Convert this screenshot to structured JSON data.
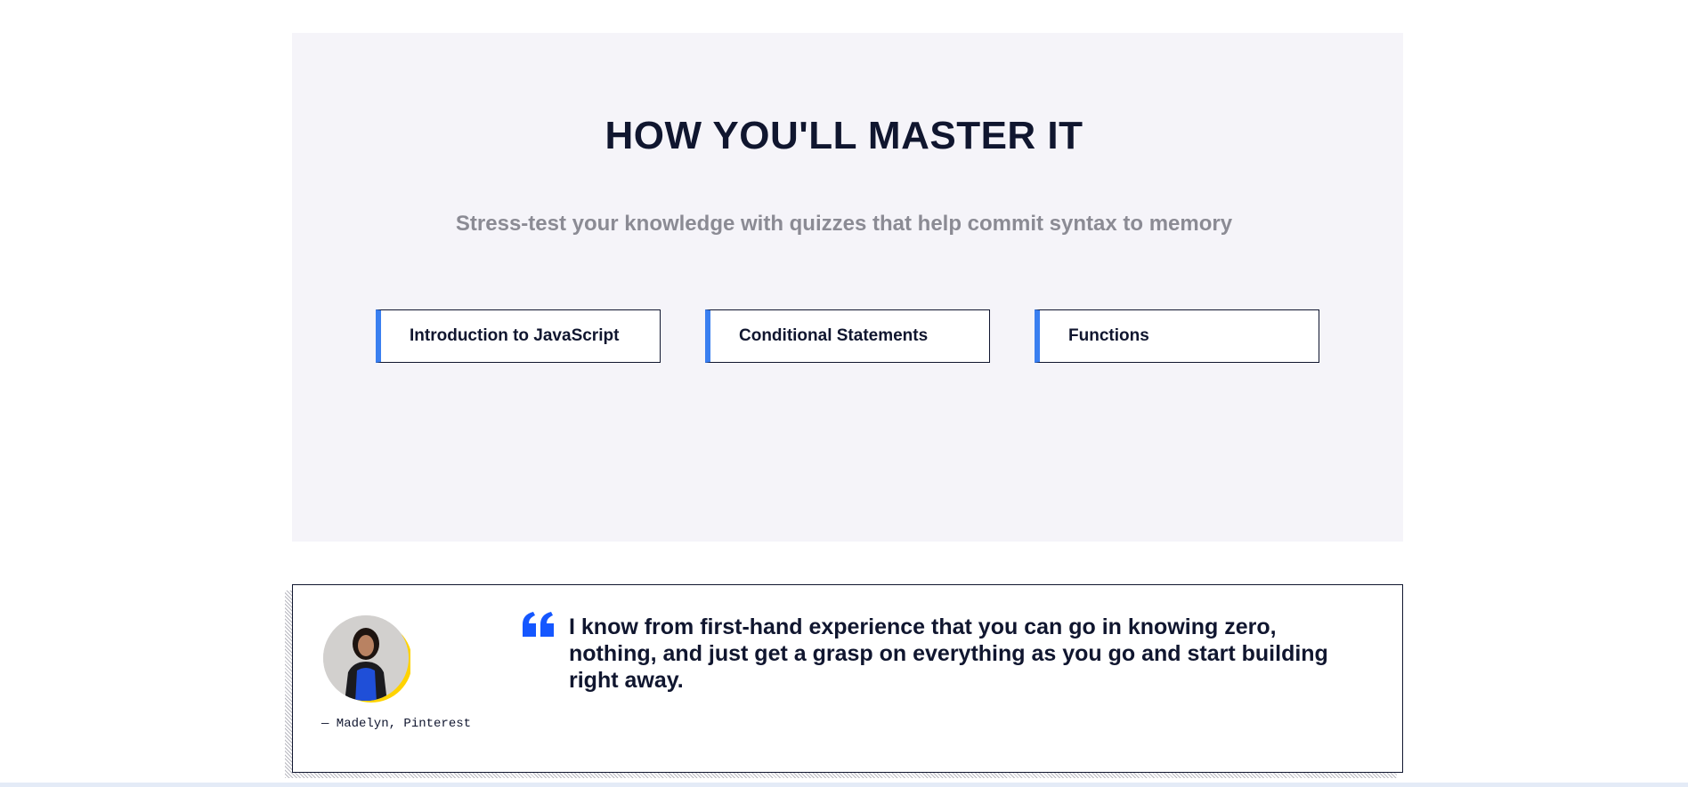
{
  "section": {
    "title": "HOW YOU'LL MASTER IT",
    "subtitle": "Stress-test your knowledge with quizzes that help commit syntax to memory"
  },
  "quizzes": [
    {
      "label": "Introduction to JavaScript"
    },
    {
      "label": "Conditional Statements"
    },
    {
      "label": "Functions"
    }
  ],
  "testimonial": {
    "quote": "I know from first-hand experience that you can go in knowing zero, nothing, and just get a grasp on everything as you go and start building right away.",
    "author": "— Madelyn, Pinterest",
    "quote_icon": "quote-mark-icon",
    "avatar_icon": "person-photo"
  },
  "colors": {
    "text": "#10162f",
    "accent": "#3a7ff0",
    "quote_blue": "#1557ff",
    "panel_bg": "#f5f4f9",
    "subtitle": "#8b8b94",
    "avatar_ring": "#ffd300"
  }
}
